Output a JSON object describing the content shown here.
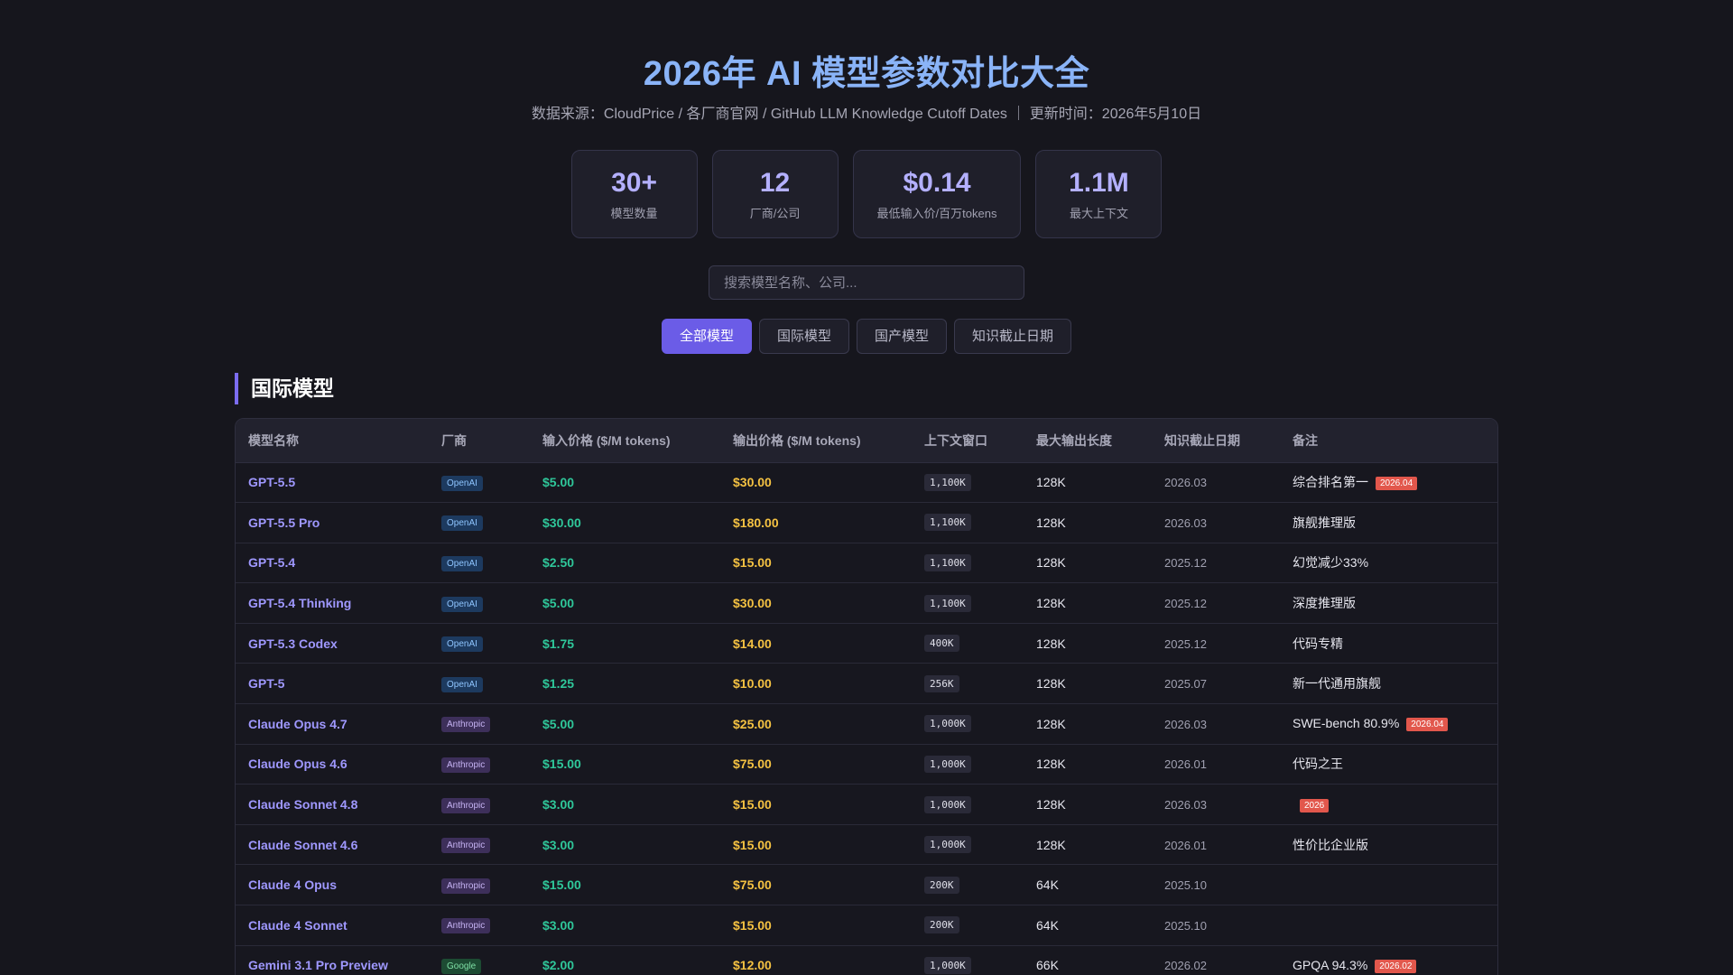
{
  "header": {
    "title": "2026年 AI 模型参数对比大全",
    "subtitle": "数据来源：CloudPrice / 各厂商官网 / GitHub LLM Knowledge Cutoff Dates ｜ 更新时间：2026年5月10日"
  },
  "stats": [
    {
      "value": "30+",
      "label": "模型数量"
    },
    {
      "value": "12",
      "label": "厂商/公司"
    },
    {
      "value": "$0.14",
      "label": "最低输入价/百万tokens"
    },
    {
      "value": "1.1M",
      "label": "最大上下文"
    }
  ],
  "search": {
    "placeholder": "搜索模型名称、公司..."
  },
  "filters": [
    "全部模型",
    "国际模型",
    "国产模型",
    "知识截止日期"
  ],
  "section": {
    "title": "国际模型"
  },
  "table": {
    "headers": [
      "模型名称",
      "厂商",
      "输入价格 ($/M tokens)",
      "输出价格 ($/M tokens)",
      "上下文窗口",
      "最大输出长度",
      "知识截止日期",
      "备注"
    ],
    "rows": [
      {
        "name": "GPT-5.5",
        "vendor": "OpenAI",
        "vendor_class": "openai",
        "input": "$5.00",
        "output": "$30.00",
        "context": "1,100K",
        "max_output": "128K",
        "cutoff": "2026.03",
        "note": "综合排名第一",
        "badge": "2026.04"
      },
      {
        "name": "GPT-5.5 Pro",
        "vendor": "OpenAI",
        "vendor_class": "openai",
        "input": "$30.00",
        "output": "$180.00",
        "context": "1,100K",
        "max_output": "128K",
        "cutoff": "2026.03",
        "note": "旗舰推理版",
        "badge": ""
      },
      {
        "name": "GPT-5.4",
        "vendor": "OpenAI",
        "vendor_class": "openai",
        "input": "$2.50",
        "output": "$15.00",
        "context": "1,100K",
        "max_output": "128K",
        "cutoff": "2025.12",
        "note": "幻觉减少33%",
        "badge": ""
      },
      {
        "name": "GPT-5.4 Thinking",
        "vendor": "OpenAI",
        "vendor_class": "openai",
        "input": "$5.00",
        "output": "$30.00",
        "context": "1,100K",
        "max_output": "128K",
        "cutoff": "2025.12",
        "note": "深度推理版",
        "badge": ""
      },
      {
        "name": "GPT-5.3 Codex",
        "vendor": "OpenAI",
        "vendor_class": "openai",
        "input": "$1.75",
        "output": "$14.00",
        "context": "400K",
        "max_output": "128K",
        "cutoff": "2025.12",
        "note": "代码专精",
        "badge": ""
      },
      {
        "name": "GPT-5",
        "vendor": "OpenAI",
        "vendor_class": "openai",
        "input": "$1.25",
        "output": "$10.00",
        "context": "256K",
        "max_output": "128K",
        "cutoff": "2025.07",
        "note": "新一代通用旗舰",
        "badge": ""
      },
      {
        "name": "Claude Opus 4.7",
        "vendor": "Anthropic",
        "vendor_class": "anthropic",
        "input": "$5.00",
        "output": "$25.00",
        "context": "1,000K",
        "max_output": "128K",
        "cutoff": "2026.03",
        "note": "SWE-bench 80.9%",
        "badge": "2026.04"
      },
      {
        "name": "Claude Opus 4.6",
        "vendor": "Anthropic",
        "vendor_class": "anthropic",
        "input": "$15.00",
        "output": "$75.00",
        "context": "1,000K",
        "max_output": "128K",
        "cutoff": "2026.01",
        "note": "代码之王",
        "badge": ""
      },
      {
        "name": "Claude Sonnet 4.8",
        "vendor": "Anthropic",
        "vendor_class": "anthropic",
        "input": "$3.00",
        "output": "$15.00",
        "context": "1,000K",
        "max_output": "128K",
        "cutoff": "2026.03",
        "note": "",
        "badge": "2026"
      },
      {
        "name": "Claude Sonnet 4.6",
        "vendor": "Anthropic",
        "vendor_class": "anthropic",
        "input": "$3.00",
        "output": "$15.00",
        "context": "1,000K",
        "max_output": "128K",
        "cutoff": "2026.01",
        "note": "性价比企业版",
        "badge": ""
      },
      {
        "name": "Claude 4 Opus",
        "vendor": "Anthropic",
        "vendor_class": "anthropic",
        "input": "$15.00",
        "output": "$75.00",
        "context": "200K",
        "max_output": "64K",
        "cutoff": "2025.10",
        "note": "",
        "badge": ""
      },
      {
        "name": "Claude 4 Sonnet",
        "vendor": "Anthropic",
        "vendor_class": "anthropic",
        "input": "$3.00",
        "output": "$15.00",
        "context": "200K",
        "max_output": "64K",
        "cutoff": "2025.10",
        "note": "",
        "badge": ""
      },
      {
        "name": "Gemini 3.1 Pro Preview",
        "vendor": "Google",
        "vendor_class": "google",
        "input": "$2.00",
        "output": "$12.00",
        "context": "1,000K",
        "max_output": "66K",
        "cutoff": "2026.02",
        "note": "GPQA 94.3%",
        "badge": "2026.02"
      }
    ]
  }
}
